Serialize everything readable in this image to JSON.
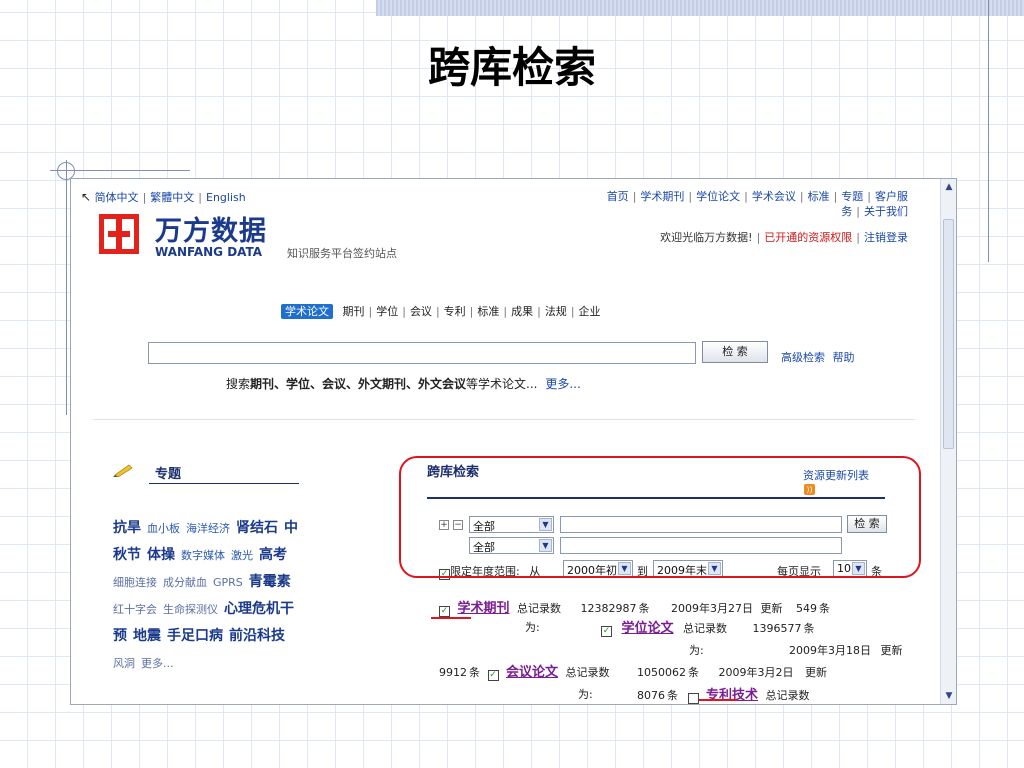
{
  "slide": {
    "title": "跨库检索"
  },
  "lang": {
    "simplified": "简体中文",
    "traditional": "繁體中文",
    "english": "English"
  },
  "topnav": {
    "items": [
      "首页",
      "学术期刊",
      "学位论文",
      "学术会议",
      "标准",
      "专题",
      "客户服"
    ],
    "line2": [
      "务",
      "关于我们"
    ]
  },
  "welcome": {
    "text": "欢迎光临万方数据!",
    "rights": "已开通的资源权限",
    "logout": "注销登录"
  },
  "logo": {
    "cn": "万方数据",
    "en": "WANFANG DATA",
    "slogan": "知识服务平台签约站点"
  },
  "tabs": {
    "active": "学术论文",
    "items": [
      "期刊",
      "学位",
      "会议",
      "专利",
      "标准",
      "成果",
      "法规",
      "企业"
    ]
  },
  "search": {
    "button": "检 索",
    "advanced": "高级检索",
    "help": "帮助",
    "hint_prefix": "搜索",
    "hint_bold": "期刊、学位、会议、外文期刊、外文会议",
    "hint_suffix": "等学术论文...",
    "more": "更多..."
  },
  "topics": {
    "heading": "专题",
    "rows": [
      [
        {
          "t": "抗旱",
          "s": "b"
        },
        {
          "t": "血小板",
          "s": "s"
        },
        {
          "t": "海洋经济",
          "s": "s"
        },
        {
          "t": "肾结石",
          "s": "b"
        },
        {
          "t": "中",
          "s": "b"
        }
      ],
      [
        {
          "t": "秋节",
          "s": "b"
        },
        {
          "t": "体操",
          "s": "b"
        },
        {
          "t": "数字媒体",
          "s": "s"
        },
        {
          "t": "激光",
          "s": "s"
        },
        {
          "t": "高考",
          "s": "b"
        }
      ],
      [
        {
          "t": "细胞连接",
          "s": "g"
        },
        {
          "t": "成分献血",
          "s": "g"
        },
        {
          "t": "GPRS",
          "s": "g"
        },
        {
          "t": "青霉素",
          "s": "b"
        }
      ],
      [
        {
          "t": "红十字会",
          "s": "g"
        },
        {
          "t": "生命探测仪",
          "s": "g"
        },
        {
          "t": "心理危机干",
          "s": "b"
        }
      ],
      [
        {
          "t": "预",
          "s": "b"
        },
        {
          "t": "地震",
          "s": "b"
        },
        {
          "t": "手足口病",
          "s": "b"
        },
        {
          "t": "前沿科技",
          "s": "b"
        }
      ],
      [
        {
          "t": "风洞",
          "s": "g"
        },
        {
          "t": "更多...",
          "s": "g"
        }
      ]
    ]
  },
  "cross": {
    "heading": "跨库检索",
    "update_list": "资源更新列表",
    "field_all": "全部",
    "button": "检 索",
    "year_limit": "限定年度范围:",
    "from": "从",
    "from_value": "2000年初",
    "to": "到",
    "to_value": "2009年末",
    "per_page": "每页显示",
    "per_page_value": "10",
    "unit": "条"
  },
  "databases": {
    "total_label": "总记录数",
    "is_label": "为:",
    "update_label": "更新",
    "unit": "条",
    "journal": {
      "name": "学术期刊",
      "total": "12382987",
      "date": "2009年3月27日",
      "update": "549"
    },
    "thesis": {
      "name": "学位论文",
      "total": "1396577",
      "date": "2009年3月18日",
      "update": "9912"
    },
    "conference": {
      "name": "会议论文",
      "total": "1050062",
      "date": "2009年3月2日",
      "update": "8076"
    },
    "patent": {
      "name": "专利技术"
    }
  }
}
